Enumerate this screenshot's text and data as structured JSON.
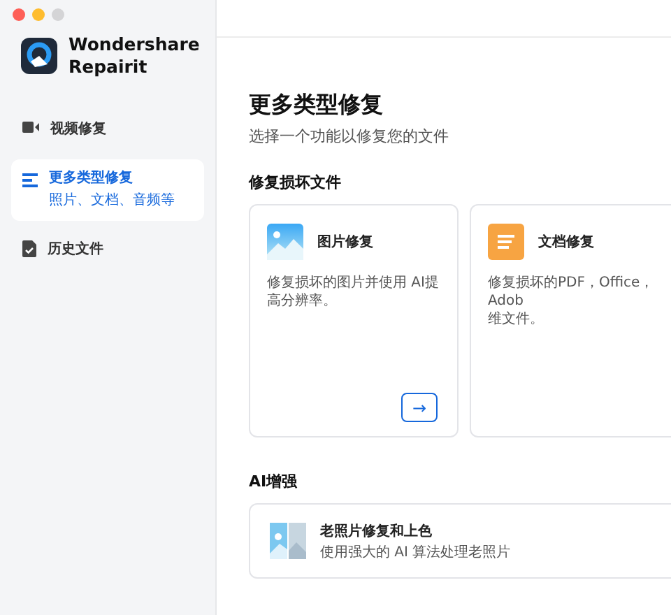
{
  "app": {
    "name_lines": [
      "Wondershare",
      "Repairit"
    ]
  },
  "sidebar": {
    "items": [
      {
        "kind": "video",
        "label": "视频修复",
        "selected": false
      },
      {
        "kind": "list",
        "label": "更多类型修复",
        "sublabel": "照片、文档、音频等",
        "selected": true
      },
      {
        "kind": "history",
        "label": "历史文件",
        "selected": false
      }
    ]
  },
  "main": {
    "title": "更多类型修复",
    "subtitle": "选择一个功能以修复您的文件",
    "sections": [
      {
        "heading": "修复损坏文件",
        "kind": "grid",
        "cards": [
          {
            "kind": "photo",
            "title": "图片修复",
            "description": [
              "修复损坏的图片并使用 AI提高分辨率。"
            ],
            "arrow": "→"
          },
          {
            "kind": "document",
            "title": "文档修复",
            "description": [
              "修复损坏的PDF，Office，Adob",
              "维文件。"
            ]
          }
        ]
      },
      {
        "heading": "AI增强",
        "kind": "list",
        "cards": [
          {
            "kind": "old-photo",
            "title": "老照片修复和上色",
            "description": [
              "使用强大的 AI 算法处理老照片"
            ]
          }
        ]
      }
    ]
  }
}
